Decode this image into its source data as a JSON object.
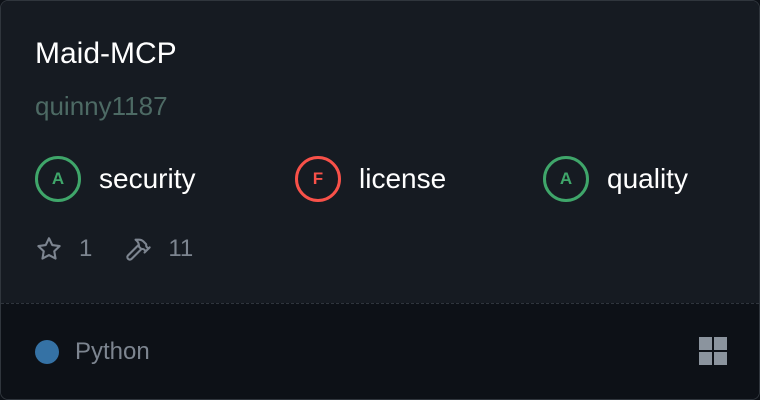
{
  "server": {
    "name": "Maid-MCP",
    "author": "quinny1187"
  },
  "grades": [
    {
      "letter": "A",
      "label": "security",
      "status": "pass"
    },
    {
      "letter": "F",
      "label": "license",
      "status": "fail"
    },
    {
      "letter": "A",
      "label": "quality",
      "status": "pass"
    }
  ],
  "stats": {
    "stars": "1",
    "tools": "11",
    "star_icon": "star-icon",
    "tools_icon": "hammer-icon"
  },
  "footer": {
    "language": "Python",
    "language_color": "#3572a5",
    "platform_icon": "windows-icon"
  },
  "colors": {
    "pass": "#3fa66a",
    "fail": "#f85149"
  }
}
